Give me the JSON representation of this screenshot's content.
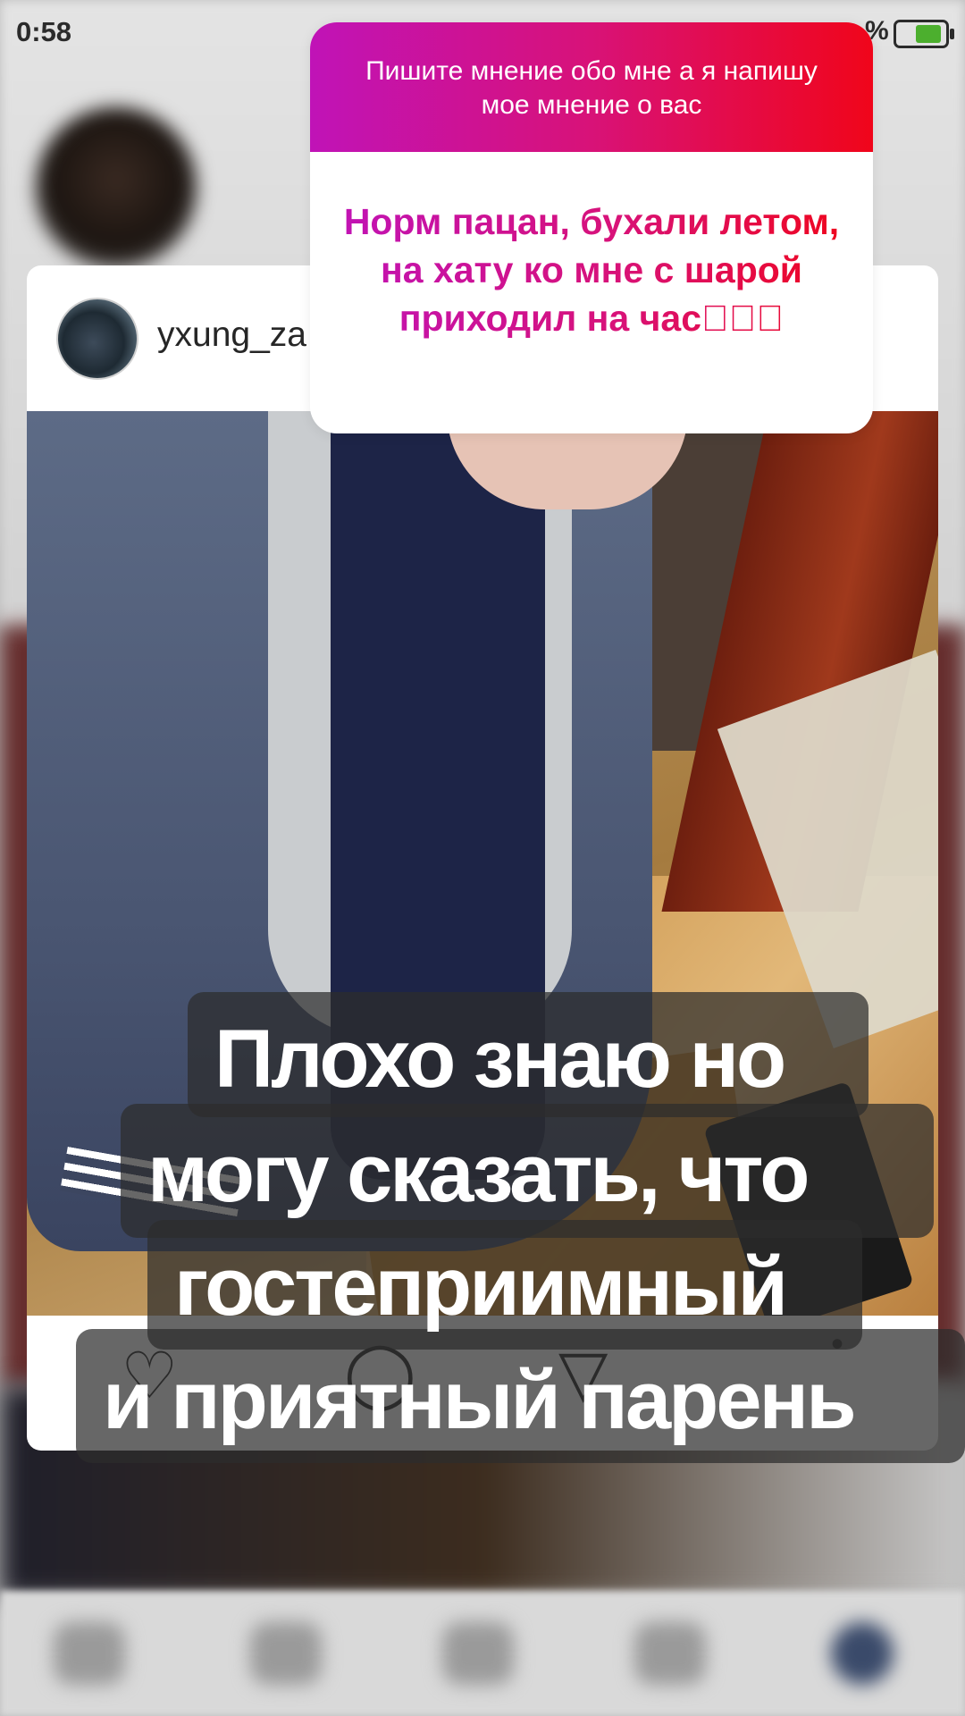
{
  "status_bar": {
    "time": "0:58",
    "battery_pct": "%"
  },
  "post": {
    "username": "yxung_za"
  },
  "sticker": {
    "question": "Пишите мнение обо мне а я напишу мое мнение о вас",
    "answer": "Норм пацан, бухали летом,  на хату ко мне с шарой приходил на час\u0000\u0000\u0000"
  },
  "caption": {
    "line1": "Плохо знаю но",
    "line2": "могу сказать, что",
    "line3": "гостеприимный",
    "line4": "и приятный парень"
  },
  "colors": {
    "gradient_start": "#c013b7",
    "gradient_end": "#f0051a"
  }
}
